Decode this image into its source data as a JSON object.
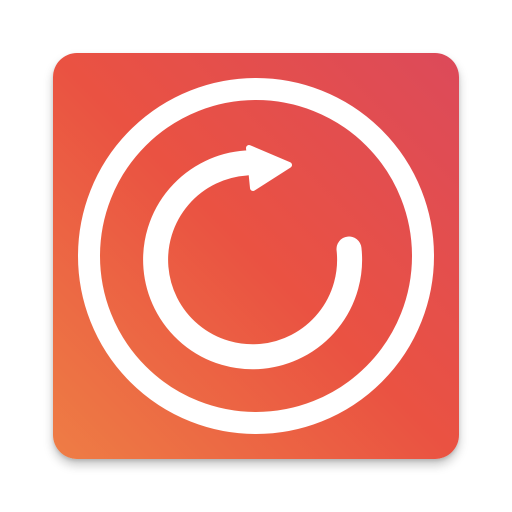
{
  "icon": {
    "name": "refresh-icon",
    "colors": {
      "gradient_top_right": "#dc4a5a",
      "gradient_center": "#ea5242",
      "gradient_bottom_left": "#ee7d45",
      "glyph": "#ffffff"
    }
  }
}
